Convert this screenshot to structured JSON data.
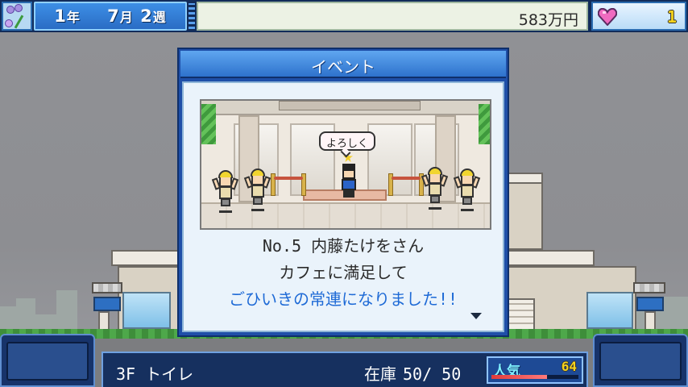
{
  "hud": {
    "date": {
      "year": "1",
      "year_unit": "年",
      "month": "7",
      "month_unit": "月",
      "week": "2",
      "week_unit": "週"
    },
    "money": "583万円",
    "hearts": "1"
  },
  "event_dialog": {
    "title": "イベント",
    "speech_bubble": "よろしく",
    "message_lines": [
      "No.5 内藤たけをさん",
      "カフェに満足して",
      "ごひいきの常連になりました!!"
    ]
  },
  "status_bar": {
    "location": "3F トイレ",
    "stock_label": "在庫",
    "stock_value": "50/ 50",
    "popularity_label": "人気",
    "popularity_value": "64",
    "popularity_ratio": 0.64
  },
  "colors": {
    "accent_blue": "#2e72cc",
    "highlight_text": "#1e6ad6",
    "number_yellow": "#f5d21c"
  },
  "icons": {
    "flower": "flower-icon",
    "heart": "heart-icon",
    "more": "triangle-down-icon"
  }
}
